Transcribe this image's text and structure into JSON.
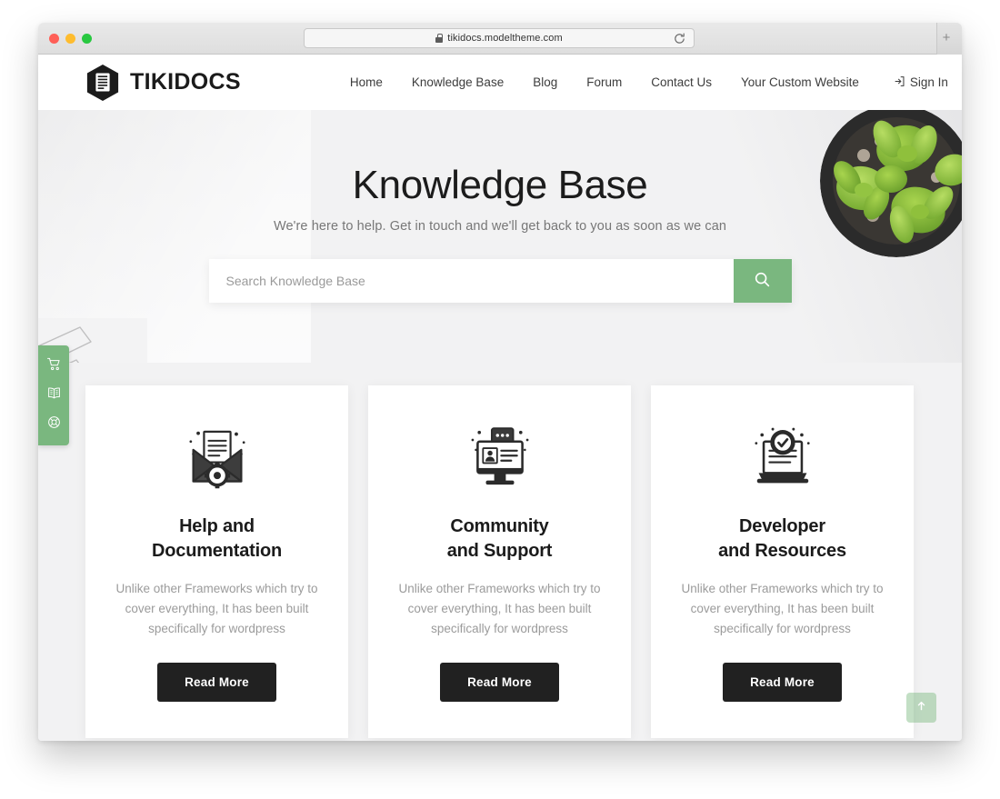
{
  "browser": {
    "url": "tikidocs.modeltheme.com",
    "lock_icon": "lock-icon",
    "reload_icon": "reload-icon",
    "new_tab_icon": "plus-icon",
    "traffic_lights": [
      "close-red",
      "minimize-yellow",
      "maximize-green"
    ]
  },
  "header": {
    "logo_text": "TIKIDOCS",
    "logo_icon": "hexagon-document-icon",
    "nav": [
      {
        "label": "Home"
      },
      {
        "label": "Knowledge Base"
      },
      {
        "label": "Blog"
      },
      {
        "label": "Forum"
      },
      {
        "label": "Contact Us"
      },
      {
        "label": "Your Custom Website"
      }
    ],
    "sign_in": {
      "label": "Sign In",
      "icon": "sign-in-icon"
    }
  },
  "hero": {
    "title": "Knowledge Base",
    "subtitle": "We're here to help. Get in touch and we'll get back to you as soon as we can",
    "search": {
      "placeholder": "Search Knowledge Base",
      "value": "",
      "button_icon": "search-icon"
    },
    "decoration": "succulent-plant-photo"
  },
  "side_widgets": [
    {
      "icon": "shopping-cart-icon",
      "name": "cart"
    },
    {
      "icon": "open-book-icon",
      "name": "documentation"
    },
    {
      "icon": "lifebuoy-icon",
      "name": "support"
    }
  ],
  "cards": [
    {
      "icon": "envelope-document-gear-icon",
      "title_line1": "Help and",
      "title_line2": "Documentation",
      "description": "Unlike other Frameworks which try to cover everything, It has been built specifically for wordpress",
      "button_label": "Read More"
    },
    {
      "icon": "monitor-profile-chat-icon",
      "title_line1": "Community",
      "title_line2": "and Support",
      "description": "Unlike other Frameworks which try to cover everything, It has been built specifically for wordpress",
      "button_label": "Read More"
    },
    {
      "icon": "laptop-check-badge-icon",
      "title_line1": "Developer",
      "title_line2": "and Resources",
      "description": "Unlike other Frameworks which try to cover everything, It has been built specifically for wordpress",
      "button_label": "Read More"
    }
  ],
  "scroll_top": {
    "icon": "arrow-up-icon"
  },
  "colors": {
    "accent_green": "#7ab77f",
    "dark_button": "#212121",
    "page_background": "#f2f2f3",
    "text_dark": "#1b1b1b",
    "text_muted": "#9b9b9b"
  }
}
